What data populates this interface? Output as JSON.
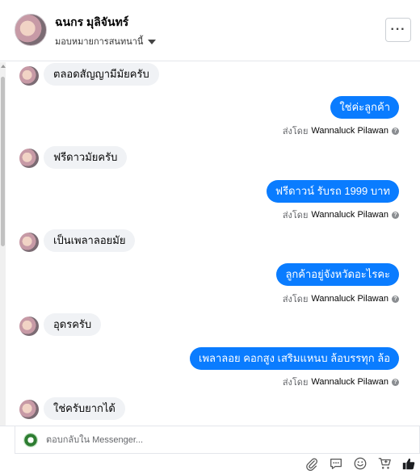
{
  "header": {
    "user_name": "ฉนกร มุลิจันทร์",
    "assign_label": "มอบหมายการสนทนานี้",
    "more_label": "···"
  },
  "messages": [
    {
      "dir": "in",
      "text": "ตลอดสัญญามีมัยครับ"
    },
    {
      "dir": "out",
      "text": "ใช่ค่ะลูกค้า",
      "sent_by_prefix": "ส่งโดย",
      "sender": "Wannaluck Pilawan"
    },
    {
      "dir": "in",
      "text": "ฟรีดาวมัยครับ"
    },
    {
      "dir": "out",
      "text": "ฟรีดาวน์  รับรถ 1999  บาท",
      "sent_by_prefix": "ส่งโดย",
      "sender": "Wannaluck Pilawan"
    },
    {
      "dir": "in",
      "text": "เป็นเพลาลอยมัย"
    },
    {
      "dir": "out",
      "text": "ลูกค้าอยู่จังหวัดอะไรคะ",
      "sent_by_prefix": "ส่งโดย",
      "sender": "Wannaluck Pilawan"
    },
    {
      "dir": "in",
      "text": "อุดรครับ"
    },
    {
      "dir": "out",
      "text": "เพลาลอย คอกสูง เสริมแหนบ ล้อบรรทุก ล้อ",
      "sent_by_prefix": "ส่งโดย",
      "sender": "Wannaluck Pilawan"
    },
    {
      "dir": "in",
      "text": "ใช่ครับยากได้"
    }
  ],
  "composer": {
    "placeholder": "ตอบกลับใน Messenger..."
  },
  "icons": {
    "more": "more-icon",
    "attach": "paperclip-icon",
    "saved_reply": "chat-bubble-icon",
    "emoji": "emoji-icon",
    "cart": "cart-icon",
    "like": "thumbs-up-icon"
  },
  "colors": {
    "outgoing_bubble": "#0a7cff",
    "incoming_bubble": "#f0f2f5",
    "like": "#1c1e21"
  }
}
